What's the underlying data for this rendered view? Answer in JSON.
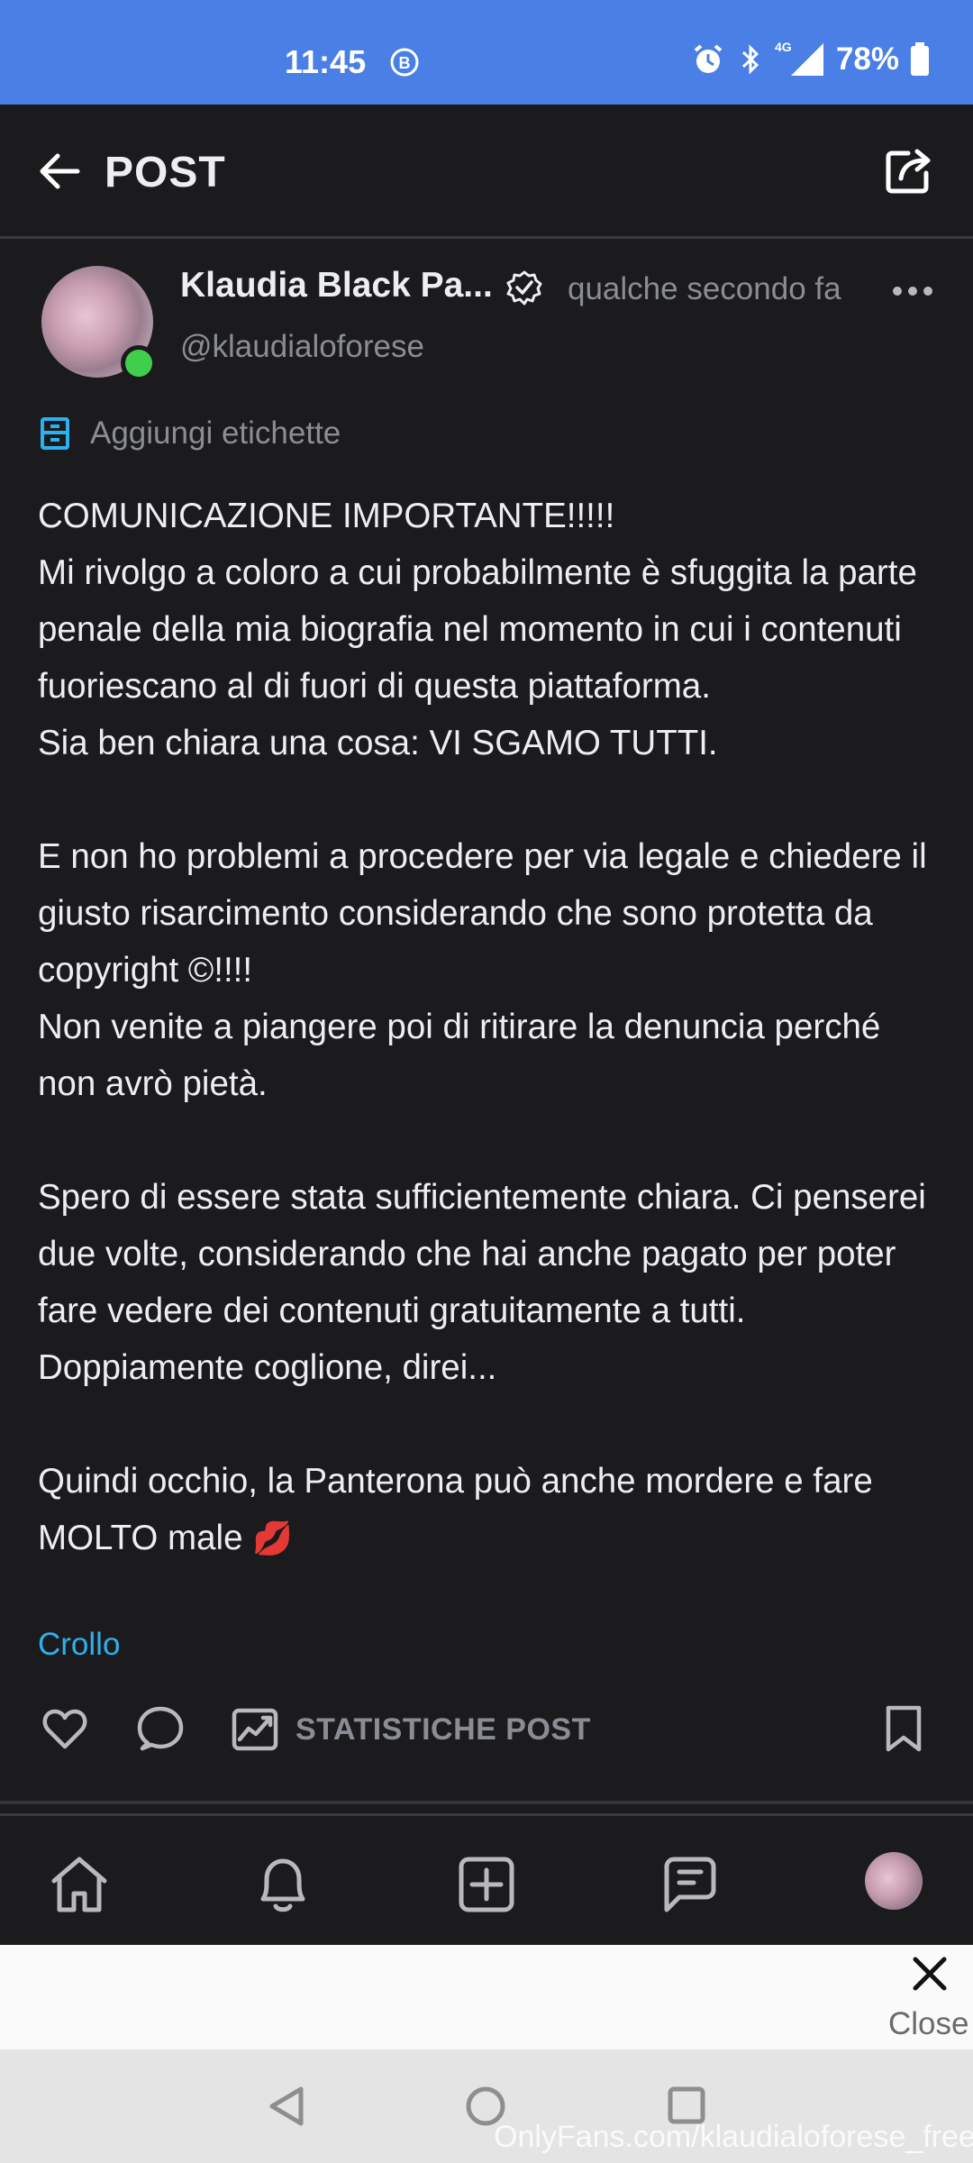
{
  "status_bar": {
    "time": "11:45",
    "network": "4G",
    "battery": "78%"
  },
  "header": {
    "title": "POST"
  },
  "post": {
    "author_name": "Klaudia Black Pa...",
    "username": "@klaudialoforese",
    "timestamp": "qualche secondo fa",
    "tag_label": "Aggiungi etichette",
    "body": "COMUNICAZIONE IMPORTANTE!!!!!\nMi rivolgo a coloro a cui probabilmente è sfuggita la parte penale della mia biografia nel momento in cui i contenuti fuoriescano al di fuori di questa piattaforma.\nSia ben chiara una cosa: VI SGAMO TUTTI.\n\nE non ho problemi a procedere per via legale e chiedere il giusto risarcimento considerando che sono protetta da copyright ©!!!!\nNon venite a piangere poi di ritirare la denuncia perché non avrò pietà.\n\nSpero di essere stata sufficientemente chiara. Ci penserei due volte, considerando che hai anche pagato per poter fare vedere dei contenuti gratuitamente a tutti. Doppiamente coglione, direi...\n\nQuindi occhio, la Panterona può anche mordere e fare MOLTO male ",
    "body_emoji": "💋",
    "translate_link": "Crollo",
    "stats_label": "STATISTICHE POST"
  },
  "ad": {
    "close_label": "Close"
  },
  "watermark": "OnlyFans.com/klaudialoforese_free",
  "colors": {
    "status_bar": "#4a7fe6",
    "background": "#1b1b1e",
    "link": "#2eb0ee",
    "online": "#3fcf4a",
    "muted": "#8a8d94"
  }
}
